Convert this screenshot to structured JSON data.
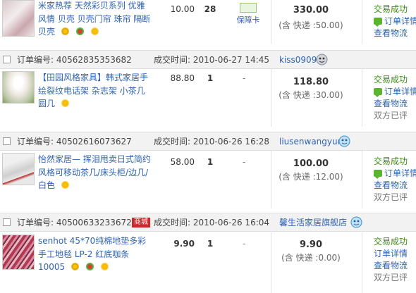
{
  "orders": [
    {
      "header": null,
      "item": {
        "title": "米家热荐 天然彩贝系列 优雅风情 贝壳 贝壳门帘 珠帘 隔断 贝壳",
        "price": "10.00",
        "qty": "28",
        "baozhang": "保障卡",
        "total": "330.00",
        "shipping": "(含 快递 :50.00)",
        "status": [
          "交易成功",
          "订单详情",
          "查看物流"
        ]
      }
    },
    {
      "header": {
        "order_label": "订单编号:",
        "order_no": "40562835353682",
        "time_label": "成交时间:",
        "time": "2010-06-27 14:45",
        "seller": "kiss0909",
        "tmall": ""
      },
      "item": {
        "title": "【田园风格家具】韩式家居手绘裂纹电话架 杂志架 小茶几 圆几",
        "price": "88.80",
        "qty": "1",
        "dash": "-",
        "total": "118.80",
        "shipping": "(含 快递 :30.00)",
        "status": [
          "交易成功",
          "订单详情",
          "查看物流",
          "双方已评"
        ]
      }
    },
    {
      "header": {
        "order_label": "订单编号:",
        "order_no": "40502616073627",
        "time_label": "成交时间:",
        "time": "2010-06-26 16:28",
        "seller": "liusenwangyun",
        "tmall": ""
      },
      "item": {
        "title": "怡然家居— 挥泪甩卖日式简约风格可移动茶几/床头柜/边几/白色",
        "price": "58.00",
        "qty": "1",
        "dash": "-",
        "total": "100.00",
        "shipping": "(含 快递 :12.00)",
        "status": [
          "交易成功",
          "订单详情",
          "查看物流",
          "双方已评"
        ]
      }
    },
    {
      "header": {
        "order_label": "订单编号:",
        "order_no": "40500633233672",
        "time_label": "成交时间:",
        "time": "2010-06-26 16:04",
        "seller": "馨生活家居旗舰店",
        "tmall": "商城"
      },
      "item": {
        "title": "senhot 45*70纯棉地垫多彩手工地毯 LP-2 红底咖条 10005",
        "price": "9.90",
        "qty": "1",
        "dash": "-",
        "total": "9.90",
        "shipping": "(含 快递 :0.00)",
        "status": [
          "交易成功",
          "订单详情",
          "查看物流",
          "双方已评"
        ]
      }
    }
  ],
  "colors": {
    "link": "#2f63b4",
    "success": "#3a8d13",
    "header_bg": "#f2f2f2",
    "tmall": "#d2262a"
  },
  "icons": [
    "checkbox-icon",
    "wangwang-icon",
    "message-icon",
    "flower-icon",
    "protection-card-icon"
  ]
}
